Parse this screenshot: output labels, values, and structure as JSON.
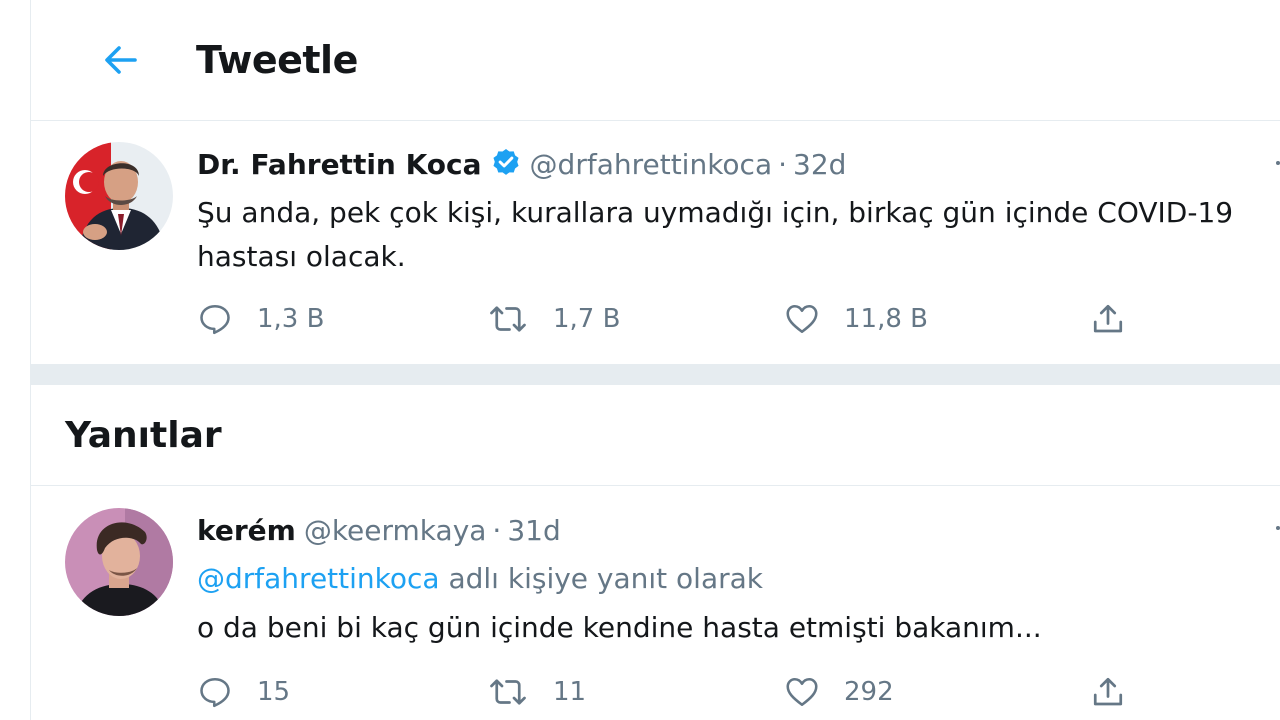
{
  "header": {
    "title": "Tweetle",
    "back_icon": "arrow-left-icon"
  },
  "tweet": {
    "display_name": "Dr. Fahrettin Koca",
    "verified": true,
    "handle": "@drfahrettinkoca",
    "separator": "·",
    "time": "32d",
    "text": "Şu anda, pek çok kişi, kurallara uymadığı için, birkaç gün içinde COVID-19 hastası olacak.",
    "counts": {
      "replies": "1,3 B",
      "retweets": "1,7 B",
      "likes": "11,8 B"
    }
  },
  "replies": {
    "title": "Yanıtlar",
    "items": [
      {
        "display_name": "kerém",
        "handle": "@keermkaya",
        "separator": "·",
        "time": "31d",
        "reply_to_mention": "@drfahrettinkoca",
        "reply_to_suffix": "adlı kişiye yanıt olarak",
        "text": "o da beni bi kaç gün içinde kendine hasta etmişti bakanım...",
        "counts": {
          "replies": "15",
          "retweets": "11",
          "likes": "292"
        }
      }
    ]
  },
  "colors": {
    "accent": "#1da1f2",
    "text": "#14171a",
    "muted": "#657786",
    "border": "#e6ecf0"
  }
}
